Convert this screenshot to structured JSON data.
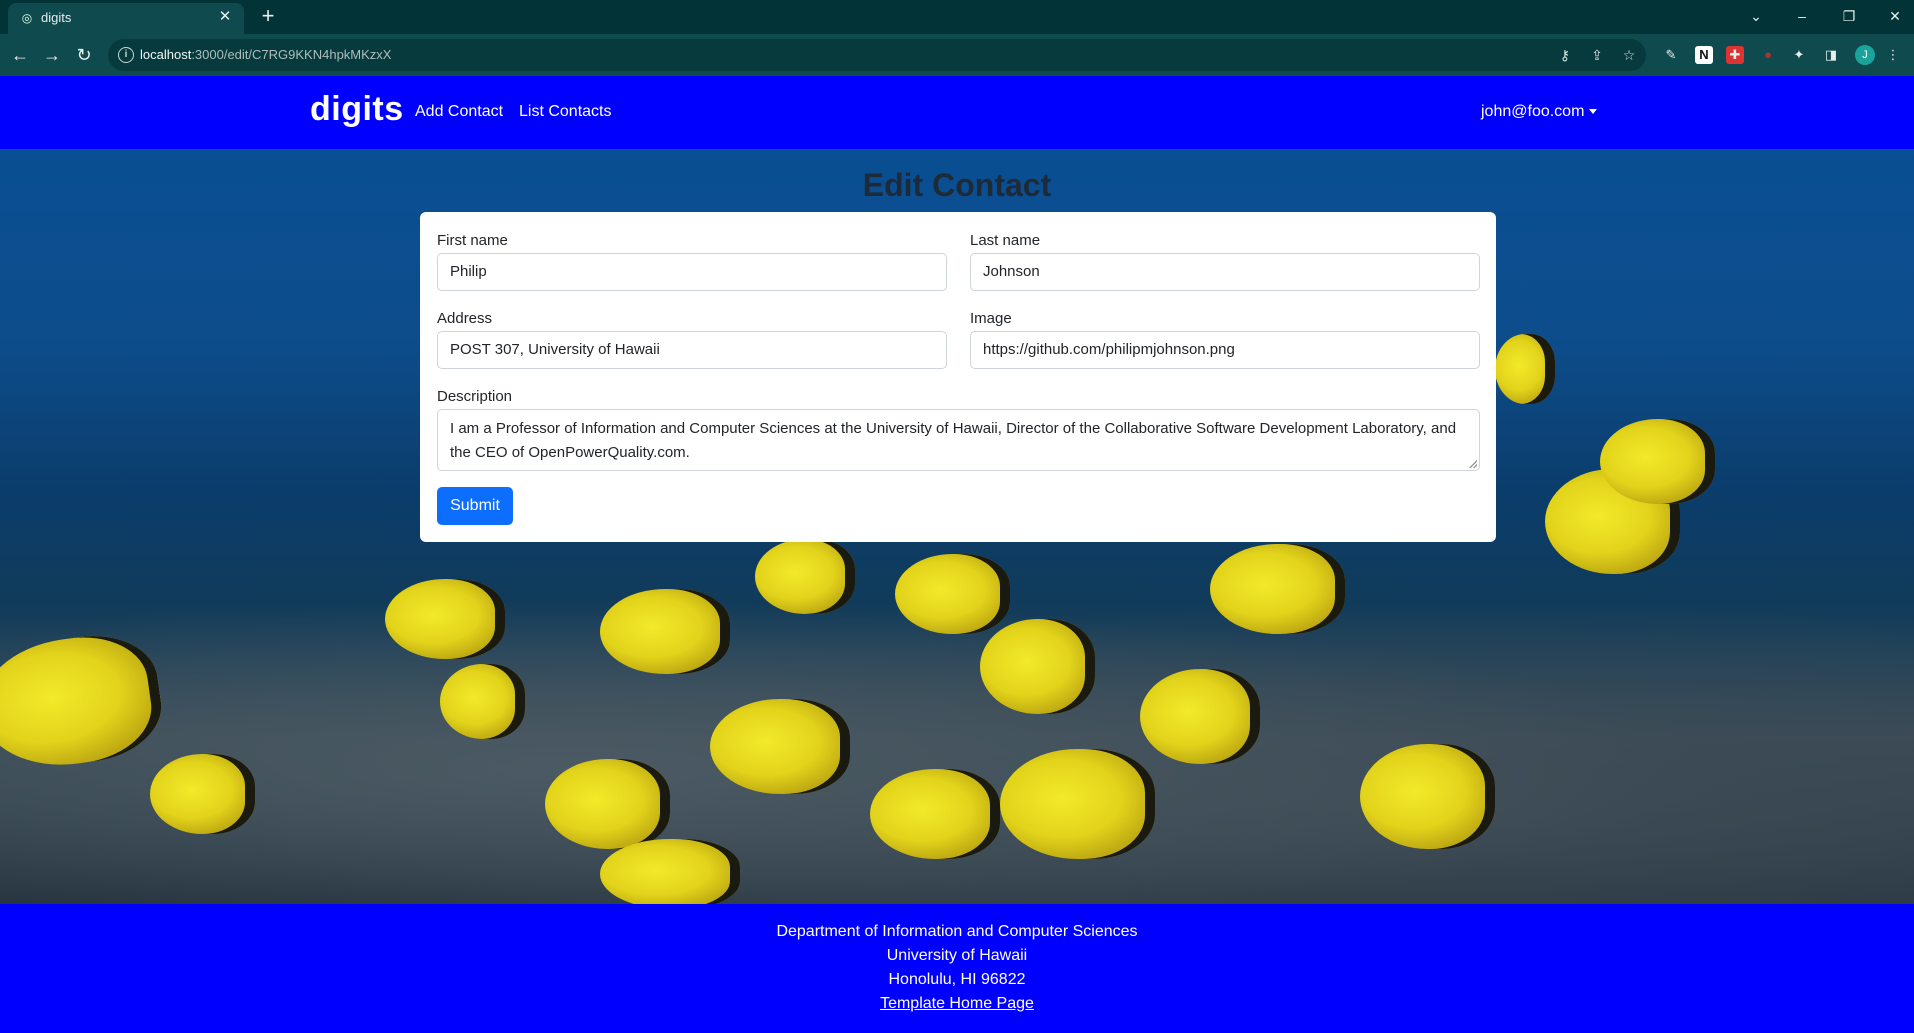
{
  "browser": {
    "tab_title": "digits",
    "url_host": "localhost",
    "url_rest": ":3000/edit/C7RG9KKN4hpkMKzxX",
    "avatar_letter": "J"
  },
  "navbar": {
    "brand": "digits",
    "links": [
      "Add Contact",
      "List Contacts"
    ],
    "user": "john@foo.com"
  },
  "page": {
    "title": "Edit Contact"
  },
  "form": {
    "first_name": {
      "label": "First name",
      "value": "Philip"
    },
    "last_name": {
      "label": "Last name",
      "value": "Johnson"
    },
    "address": {
      "label": "Address",
      "value": "POST 307, University of Hawaii"
    },
    "image": {
      "label": "Image",
      "value": "https://github.com/philipmjohnson.png"
    },
    "description": {
      "label": "Description",
      "value": "I am a Professor of Information and Computer Sciences at the University of Hawaii, Director of the Collaborative Software Development Laboratory, and the CEO of OpenPowerQuality.com."
    },
    "submit_label": "Submit"
  },
  "footer": {
    "lines": [
      "Department of Information and Computer Sciences",
      "University of Hawaii",
      "Honolulu, HI 96822"
    ],
    "link": "Template Home Page"
  },
  "colors": {
    "brand_blue": "#0000ff",
    "button_blue": "#0d6efd"
  }
}
